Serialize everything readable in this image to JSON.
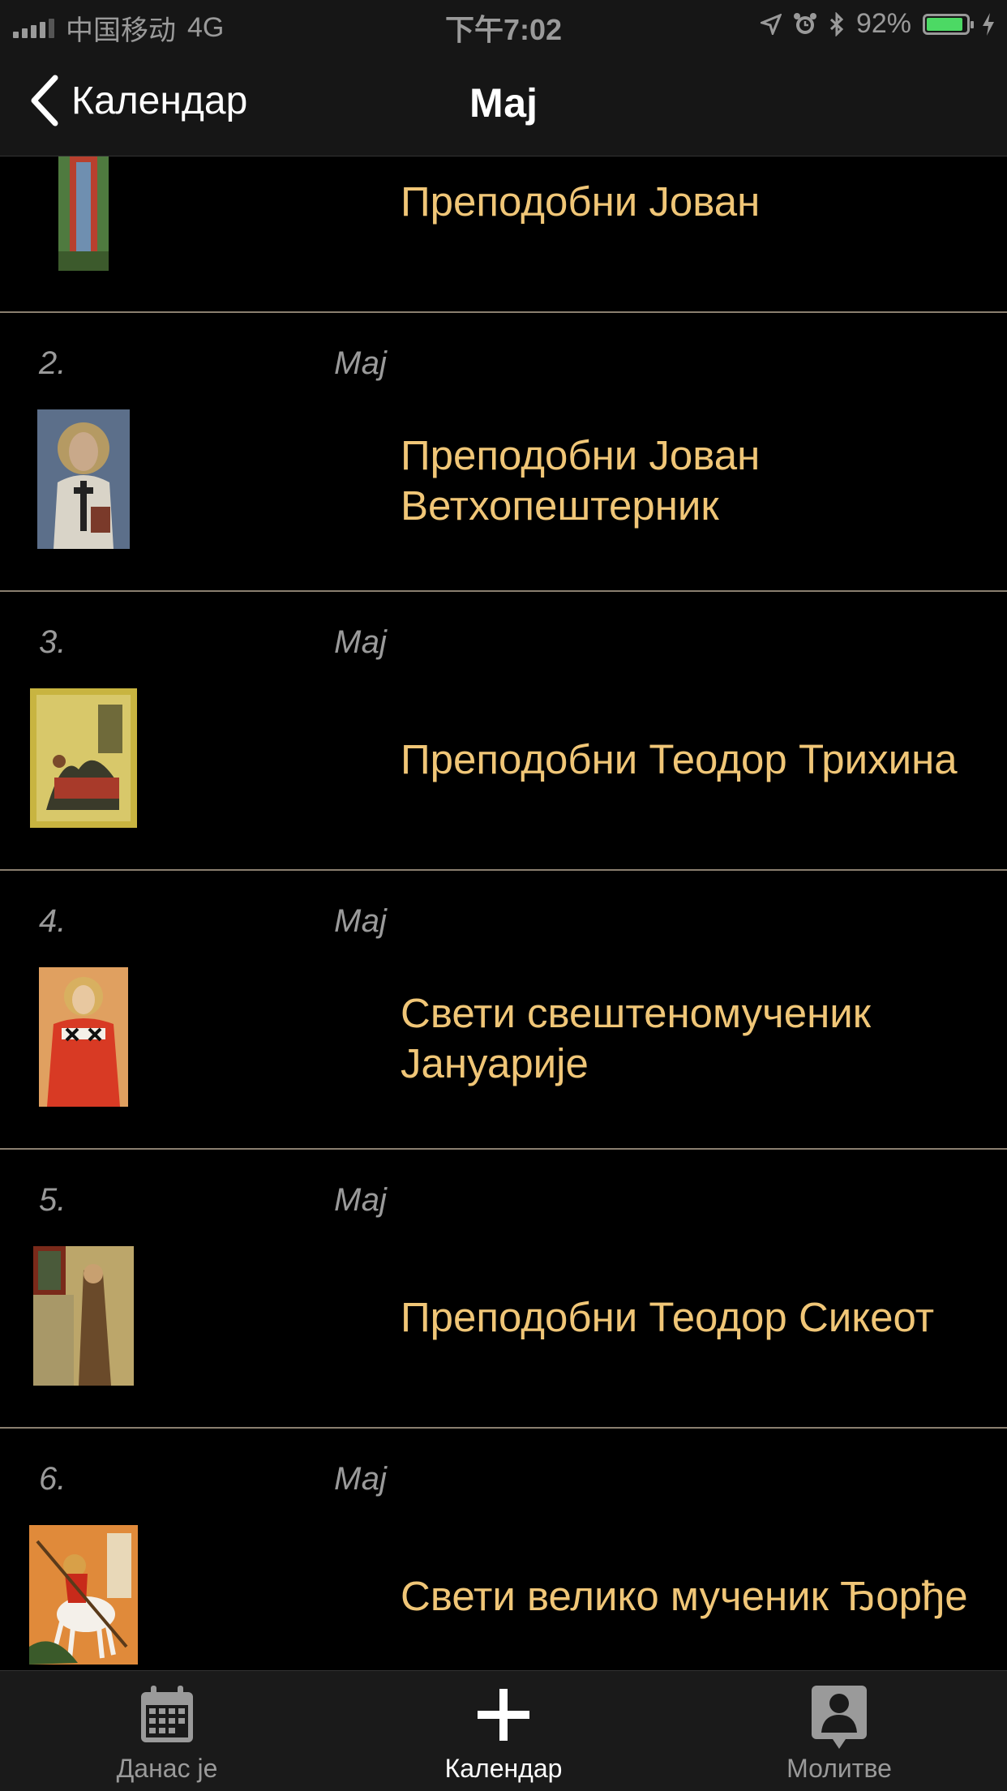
{
  "status_bar": {
    "carrier": "中国移动",
    "network": "4G",
    "time": "下午7:02",
    "battery": "92%",
    "battery_level": 0.92
  },
  "nav": {
    "back_label": "Календар",
    "title": "Мај"
  },
  "entries": [
    {
      "day": "",
      "month": "",
      "name": "Преподобни Јован",
      "icon": "saint-icon"
    },
    {
      "day": "2.",
      "month": "Мај",
      "name": "Преподобни Јован Ветхопештерник",
      "icon": "saint-icon"
    },
    {
      "day": "3.",
      "month": "Мај",
      "name": "Преподобни Теодор Трихина",
      "icon": "saint-icon"
    },
    {
      "day": "4.",
      "month": "Мај",
      "name": "Свети свештеномученик Јануарије",
      "icon": "saint-icon"
    },
    {
      "day": "5.",
      "month": "Мај",
      "name": "Преподобни Теодор Сикеот",
      "icon": "saint-icon"
    },
    {
      "day": "6.",
      "month": "Мај",
      "name": "Свети велико мученик Ђорђе",
      "icon": "saint-icon"
    }
  ],
  "tabs": [
    {
      "label": "Данас је",
      "icon": "calendar-icon"
    },
    {
      "label": "Календар",
      "icon": "cross-icon",
      "active": true
    },
    {
      "label": "Молитве",
      "icon": "person-icon"
    }
  ],
  "colors": {
    "accent_text": "#f0c677",
    "separator": "#8a7f6f",
    "background": "#000000"
  }
}
